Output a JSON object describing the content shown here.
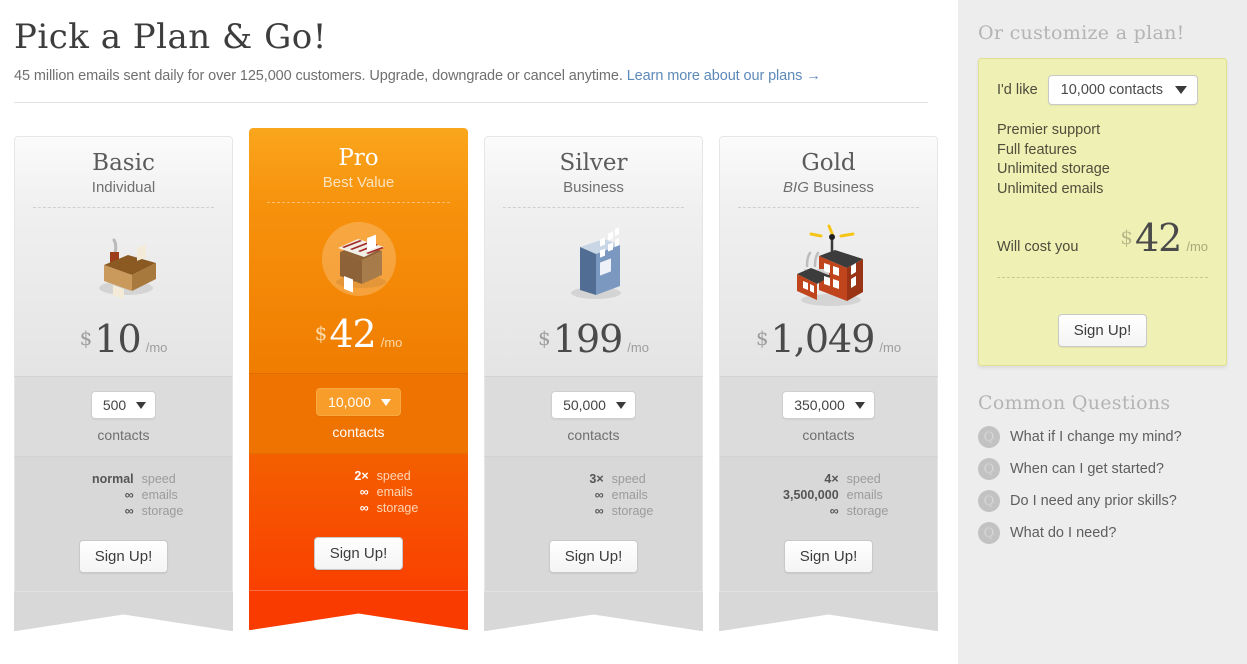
{
  "header": {
    "title": "Pick a Plan & Go!",
    "subtitle_text": "45 million emails sent daily for over 125,000 customers. Upgrade, downgrade or cancel anytime.",
    "link_text": "Learn more about our plans →"
  },
  "plans": [
    {
      "name": "Basic",
      "sub": "Individual",
      "sub_prefix": "",
      "icon": "house-icon",
      "currency": "$",
      "price": "10",
      "per": "/mo",
      "contacts_value": "500",
      "contacts_label": "contacts",
      "features": [
        {
          "value": "normal",
          "label": "speed"
        },
        {
          "value": "∞",
          "label": "emails"
        },
        {
          "value": "∞",
          "label": "storage"
        }
      ],
      "signup_label": "Sign Up!"
    },
    {
      "name": "Pro",
      "sub": "Best Value",
      "sub_prefix": "",
      "icon": "shop-awning-icon",
      "currency": "$",
      "price": "42",
      "per": "/mo",
      "contacts_value": "10,000",
      "contacts_label": "contacts",
      "features": [
        {
          "value": "2×",
          "label": "speed"
        },
        {
          "value": "∞",
          "label": "emails"
        },
        {
          "value": "∞",
          "label": "storage"
        }
      ],
      "signup_label": "Sign Up!"
    },
    {
      "name": "Silver",
      "sub": "Business",
      "sub_prefix": "",
      "icon": "office-building-icon",
      "currency": "$",
      "price": "199",
      "per": "/mo",
      "contacts_value": "50,000",
      "contacts_label": "contacts",
      "features": [
        {
          "value": "3×",
          "label": "speed"
        },
        {
          "value": "∞",
          "label": "emails"
        },
        {
          "value": "∞",
          "label": "storage"
        }
      ],
      "signup_label": "Sign Up!"
    },
    {
      "name": "Gold",
      "sub": "Business",
      "sub_prefix": "BIG",
      "icon": "factory-icon",
      "currency": "$",
      "price": "1,049",
      "per": "/mo",
      "contacts_value": "350,000",
      "contacts_label": "contacts",
      "features": [
        {
          "value": "4×",
          "label": "speed"
        },
        {
          "value": "3,500,000",
          "label": "emails"
        },
        {
          "value": "∞",
          "label": "storage"
        }
      ],
      "signup_label": "Sign Up!"
    }
  ],
  "sidebar": {
    "customize_title": "Or customize a plan!",
    "ild_like_label": "I'd like",
    "contacts_selected": "10,000 contacts",
    "customize_features": [
      "Premier support",
      "Full features",
      "Unlimited storage",
      "Unlimited emails"
    ],
    "cost_label": "Will cost you",
    "cost_currency": "$",
    "cost_price": "42",
    "cost_per": "/mo",
    "customize_signup_label": "Sign Up!",
    "faq_title": "Common Questions",
    "faq_badge": "Q",
    "faq_items": [
      "What if I change my mind?",
      "When can I get started?",
      "Do I need any prior skills?",
      "What do I need?"
    ]
  },
  "colors": {
    "accent_orange": "#f07d00",
    "accent_orange_deep": "#fa4000",
    "link_blue": "#5d89b9",
    "sidebar_bg": "#ededed",
    "customize_bg": "#eef0b4"
  }
}
